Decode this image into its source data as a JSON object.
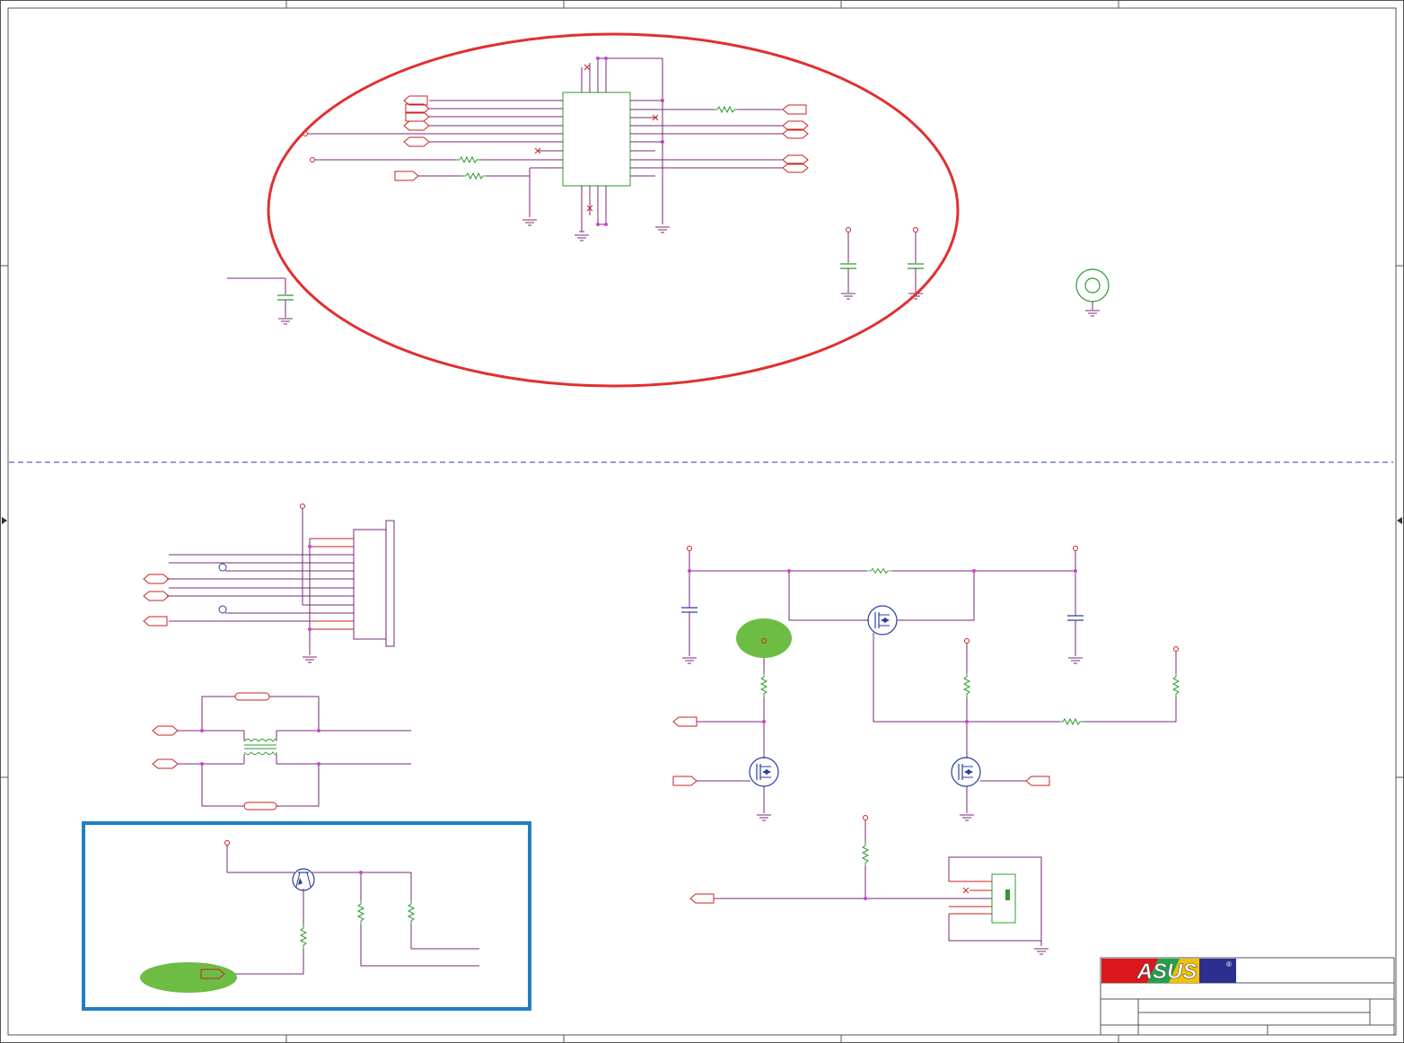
{
  "sheet": {
    "logo_text": "ASUS",
    "logo_mark": "®"
  },
  "colors": {
    "wire": "#7a2a7a",
    "pin": "#cc2222",
    "part": "#2e9b2e",
    "transistor": "#2a3f9e",
    "border": "#555555",
    "highlight_red": "#e03030",
    "highlight_blue": "#1f7fc4",
    "highlight_green": "#6dbd45",
    "divider": "#2a3f9e",
    "logo_red": "#d9171c",
    "logo_blue": "#2d2f8f"
  },
  "icons": {
    "ground": "ground-icon",
    "resistor": "resistor-icon",
    "capacitor": "capacitor-icon",
    "mosfet": "mosfet-icon",
    "bjt": "bjt-icon",
    "connector": "connector-icon",
    "transformer": "transformer-icon",
    "mounting_hole": "mounting-hole-icon",
    "port": "net-port-icon"
  }
}
